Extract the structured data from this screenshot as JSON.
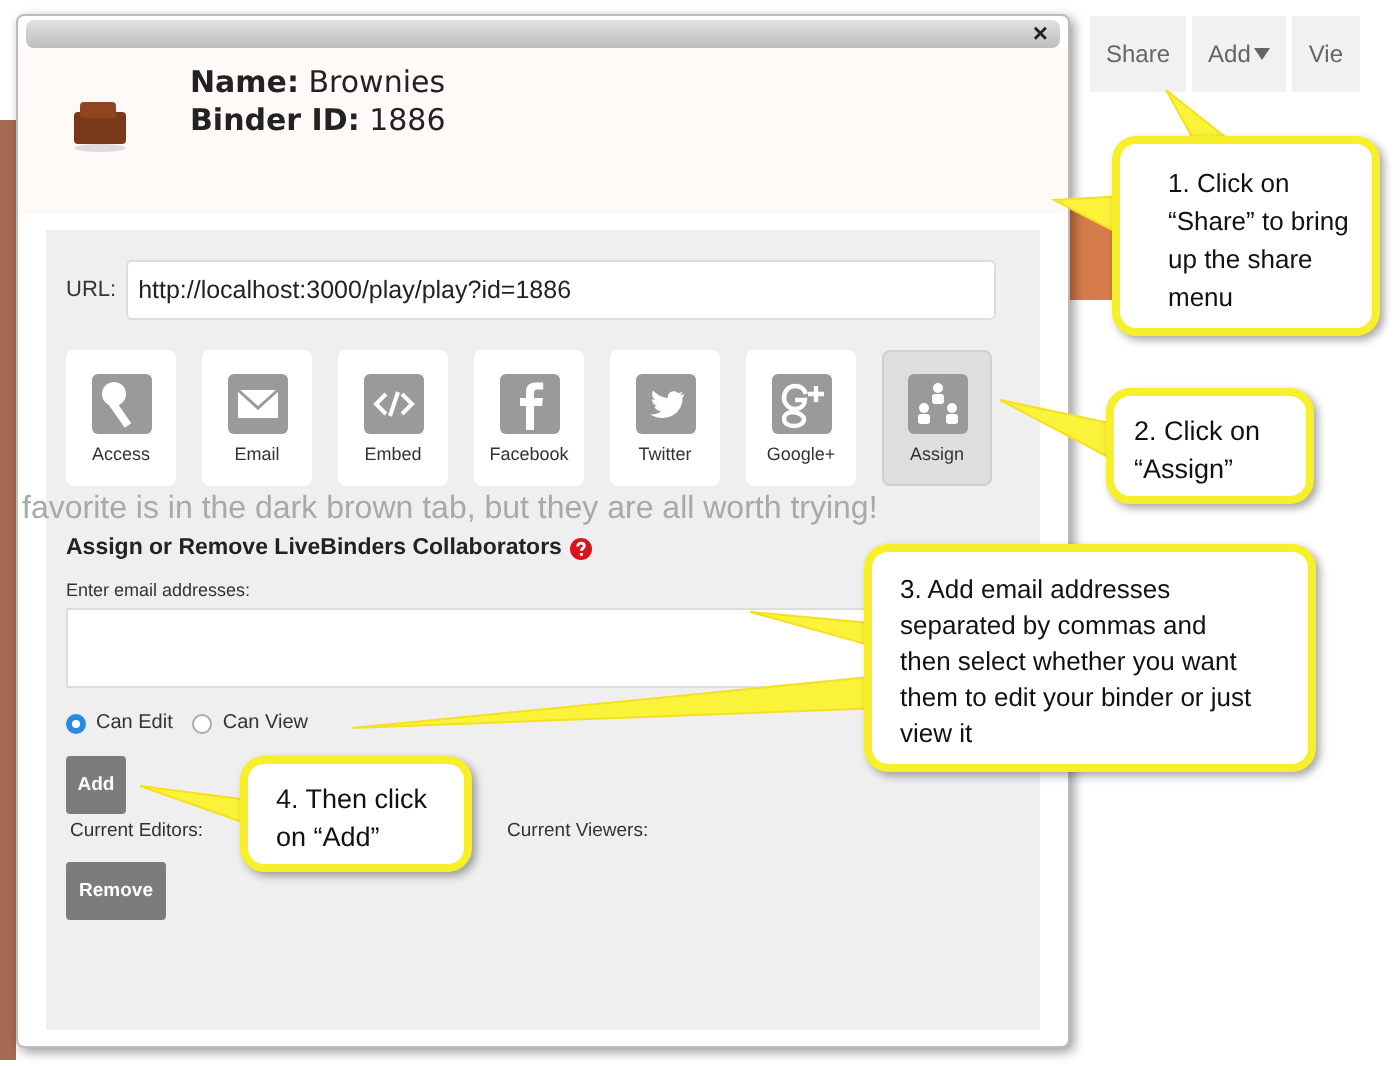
{
  "nav_buttons": [
    {
      "label": "Share",
      "kind": "plain"
    },
    {
      "label": "Add",
      "kind": "dropdown"
    },
    {
      "label": "Vie",
      "kind": "plain"
    }
  ],
  "dialog": {
    "close": "×",
    "name_label": "Name:",
    "name": "Brownies",
    "binder_label": "Binder ID:",
    "binder_id": "1886",
    "url_label": "URL:",
    "url": "http://localhost:3000/play/play?id=1886",
    "share_options": [
      {
        "label": "Access",
        "kind": "key",
        "selected": false
      },
      {
        "label": "Email",
        "kind": "envelope",
        "selected": false
      },
      {
        "label": "Embed",
        "kind": "code",
        "selected": false
      },
      {
        "label": "Facebook",
        "kind": "facebook",
        "selected": false
      },
      {
        "label": "Twitter",
        "kind": "bird",
        "selected": false
      },
      {
        "label": "Google+",
        "kind": "gplus",
        "selected": false
      },
      {
        "label": "Assign",
        "kind": "people",
        "selected": true
      }
    ],
    "background_text": "favorite is in the dark brown tab, but they are all worth trying!",
    "section_title": "Assign or Remove LiveBinders Collaborators",
    "email_label": "Enter email addresses:",
    "roles": [
      {
        "label": "Can Edit",
        "selected": true
      },
      {
        "label": "Can View",
        "selected": false
      }
    ],
    "add_button": "Add",
    "current_editors": "Current Editors:",
    "current_viewers": "Current Viewers:",
    "remove_button": "Remove"
  },
  "callouts": [
    {
      "text": "1. Click on “Share” to bring up the share menu"
    },
    {
      "text": "2. Click on “Assign”"
    },
    {
      "text": "3. Add email addresses separated by commas and then select whether you want them to edit your binder or just view it"
    },
    {
      "text": "4. Then click on “Add”"
    }
  ]
}
